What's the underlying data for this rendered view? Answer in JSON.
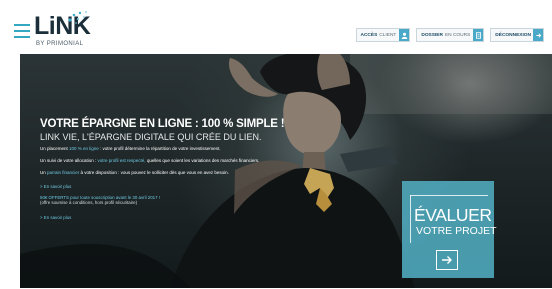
{
  "header": {
    "logo_text": "LiNK",
    "logo_sub": "BY PRIMONIAL",
    "buttons": [
      {
        "bold": "ACCÈS",
        "normal": "CLIENT",
        "icon": "user-icon"
      },
      {
        "bold": "DOSSIER",
        "normal": "EN COURS",
        "icon": "document-icon"
      },
      {
        "bold": "DÉCONNEXION",
        "normal": "",
        "icon": "arrow-icon"
      }
    ]
  },
  "hero": {
    "headline": "VOTRE ÉPARGNE EN LIGNE : 100 % SIMPLE !",
    "subhead": "LINK VIE, L'ÉPARGNE DIGITALE QUI CRÉE DU LIEN.",
    "paragraphs": [
      {
        "pre": "Un placement ",
        "hl": "100 % en ligne",
        "post": " : votre profil détermine la répartition de votre investissement."
      },
      {
        "pre": "Un suivi de votre allocation : ",
        "hl": "votre profil est respecté,",
        "post": " quelles que soient les variations des marchés financiers."
      },
      {
        "pre": "Un ",
        "hl": "parrain financier",
        "post": " à votre disposition : vous pouvez le solliciter dès que vous en avez besoin."
      }
    ],
    "more_link_1": "> En savoir plus",
    "offer_line1": "50€ OFFERTS pour toute souscription avant le 30 avril 2017 !",
    "offer_line2": "(offre soumise à conditions, hors profil sécuritaire)",
    "more_link_2": "> En savoir plus"
  },
  "cta": {
    "title": "ÉVALUER",
    "subtitle": "VOTRE PROJET",
    "icon": "arrow-right-icon"
  },
  "colors": {
    "accent": "#4aa8c8",
    "cta_bg": "#52b0c4",
    "logo": "#1b2f3a"
  }
}
